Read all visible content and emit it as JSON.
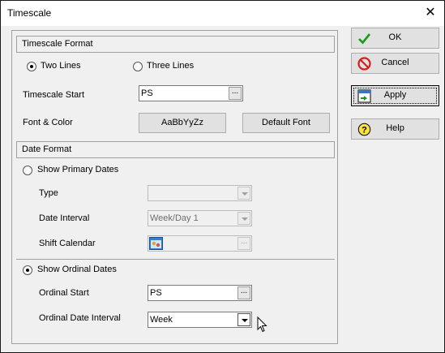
{
  "window": {
    "title": "Timescale",
    "close_glyph": "✕"
  },
  "timescale_format": {
    "header": "Timescale Format",
    "radio_two_lines": "Two Lines",
    "radio_three_lines": "Three Lines",
    "selected": "Two Lines",
    "start_label": "Timescale Start",
    "start_value": "PS",
    "font_color_label": "Font & Color",
    "font_sample_button": "AaBbYyZz",
    "default_font_button": "Default Font"
  },
  "date_format": {
    "header": "Date Format",
    "show_primary_dates": "Show Primary Dates",
    "type_label": "Type",
    "type_value": "",
    "date_interval_label": "Date Interval",
    "date_interval_value": "Week/Day 1",
    "shift_calendar_label": "Shift Calendar",
    "show_ordinal_dates": "Show Ordinal Dates",
    "selected": "Show Ordinal Dates",
    "ordinal_start_label": "Ordinal Start",
    "ordinal_start_value": "PS",
    "ordinal_interval_label": "Ordinal Date Interval",
    "ordinal_interval_value": "Week"
  },
  "buttons": {
    "ok": "OK",
    "cancel": "Cancel",
    "apply": "Apply",
    "help": "Help"
  },
  "ellipsis_glyph": "...",
  "icons": {
    "ok": "checkmark-icon",
    "cancel": "no-entry-icon",
    "apply": "apply-icon",
    "help": "help-icon",
    "shift_calendar": "calendar-icon"
  },
  "colors": {
    "ok_check": "#1a9a1a",
    "cancel_red": "#d81c1c",
    "help_yellow": "#ffe23a"
  }
}
